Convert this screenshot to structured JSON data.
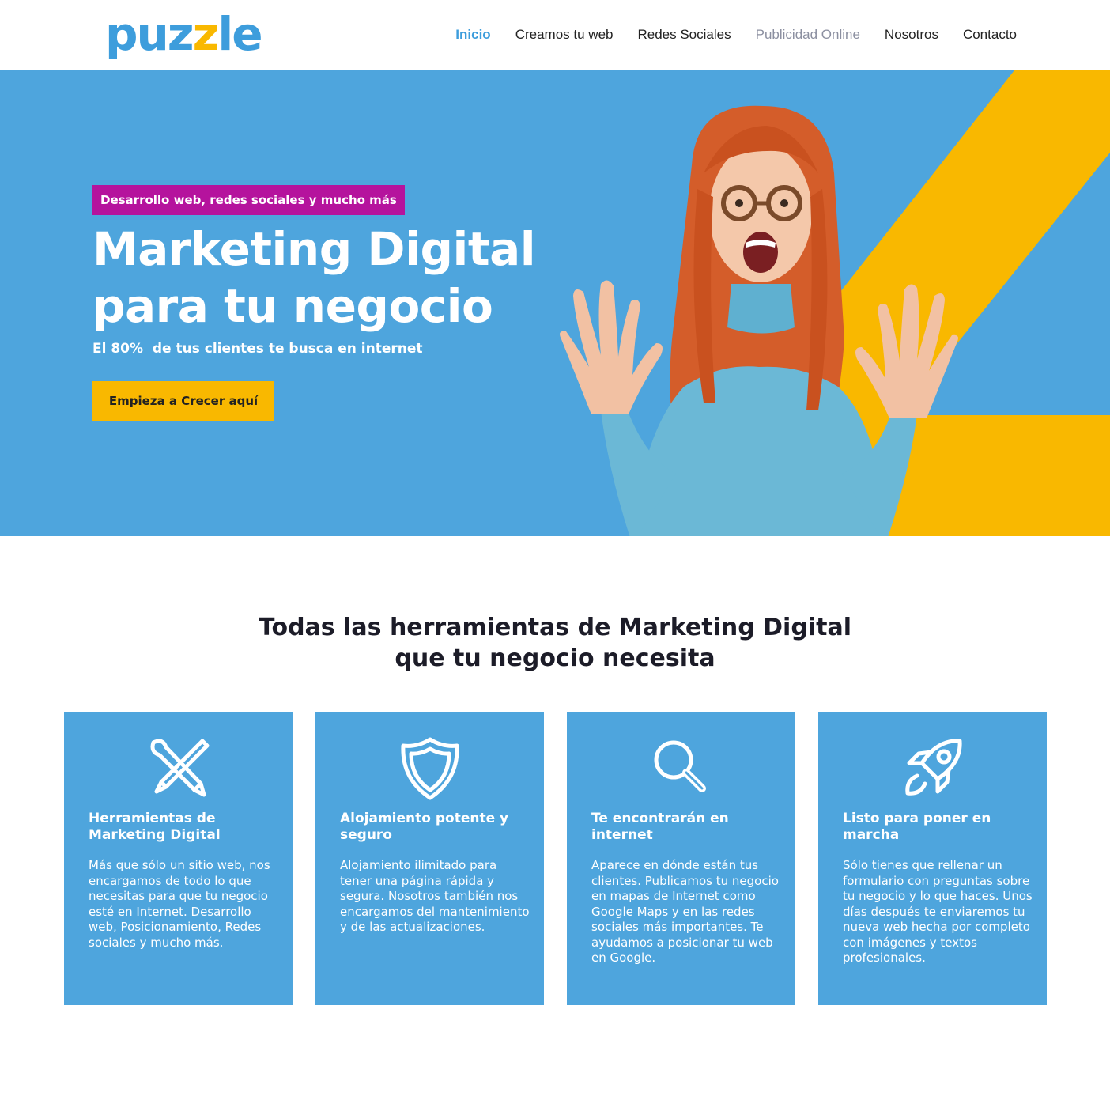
{
  "header": {
    "logo": {
      "text_a": "puz",
      "text_b": "z",
      "text_c": "le"
    },
    "nav": [
      {
        "label": "Inicio",
        "state": "active"
      },
      {
        "label": "Creamos tu web",
        "state": "normal"
      },
      {
        "label": "Redes Sociales",
        "state": "normal"
      },
      {
        "label": "Publicidad Online",
        "state": "muted"
      },
      {
        "label": "Nosotros",
        "state": "normal"
      },
      {
        "label": "Contacto",
        "state": "normal"
      }
    ]
  },
  "hero": {
    "tagline": "Desarrollo web, redes sociales y mucho más",
    "title": "Marketing Digital para tu negocio",
    "subtitle": "El 80%  de tus clientes te busca en internet",
    "cta": "Empieza a Crecer aquí"
  },
  "features": {
    "title": "Todas las herramientas de Marketing Digital que tu negocio necesita",
    "cards": [
      {
        "icon": "design-tools-icon",
        "title": "Herramientas de Marketing Digital",
        "text": "Más que sólo un sitio web, nos encargamos de todo lo que necesitas para que tu negocio esté en Internet. Desarrollo web, Posicionamiento, Redes sociales y mucho más."
      },
      {
        "icon": "shield-icon",
        "title": "Alojamiento potente y seguro",
        "text": "Alojamiento ilimitado para tener una página rápida y segura. Nosotros también nos encargamos del mantenimiento y de las actualizaciones."
      },
      {
        "icon": "search-icon",
        "title": "Te encontrarán en internet",
        "text": "Aparece en dónde están tus clientes. Publicamos tu negocio en mapas de Internet como Google Maps y en las redes sociales más importantes. Te ayudamos a posicionar tu web en Google."
      },
      {
        "icon": "rocket-icon",
        "title": "Listo para poner en marcha",
        "text": "Sólo tienes que rellenar un formulario con preguntas sobre tu negocio y lo que haces. Unos días después te enviaremos tu nueva web hecha por completo con imágenes y textos profesionales."
      }
    ]
  },
  "colors": {
    "brand_blue": "#4ea5dd",
    "brand_yellow": "#f9b800",
    "tag_magenta": "#b5139d"
  }
}
